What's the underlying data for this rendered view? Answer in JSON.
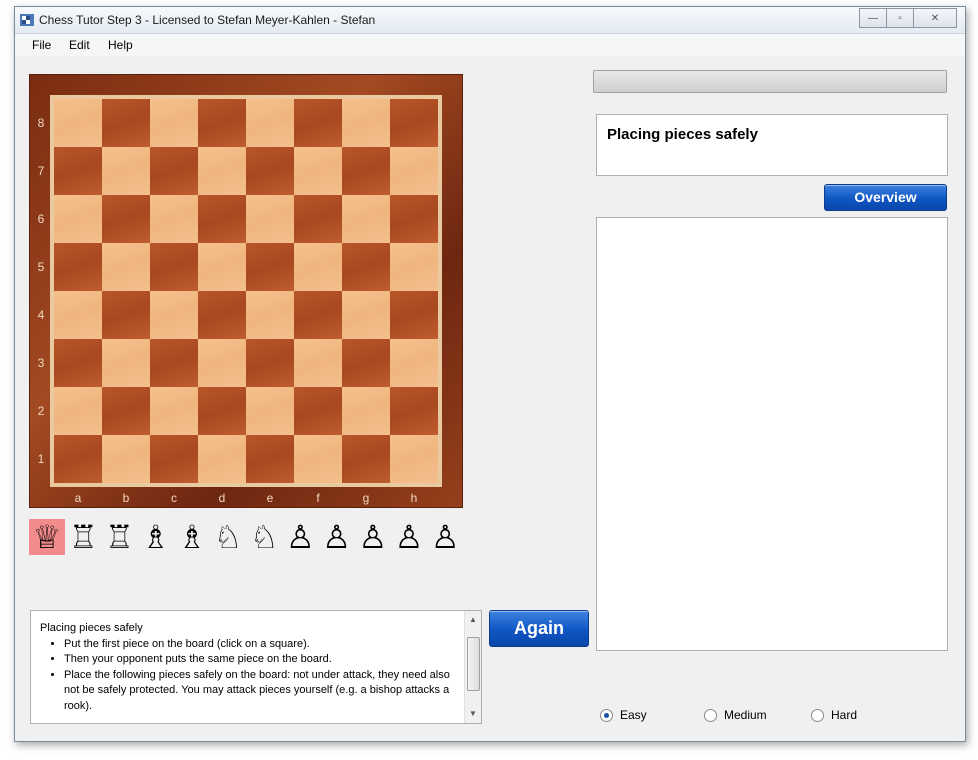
{
  "window": {
    "title": "Chess Tutor Step 3 - Licensed to Stefan Meyer-Kahlen - Stefan",
    "controls": {
      "minimize": "—",
      "maximize": "▫",
      "close": "✕"
    }
  },
  "menu": [
    "File",
    "Edit",
    "Help"
  ],
  "board": {
    "ranks": [
      "8",
      "7",
      "6",
      "5",
      "4",
      "3",
      "2",
      "1"
    ],
    "files": [
      "a",
      "b",
      "c",
      "d",
      "e",
      "f",
      "g",
      "h"
    ],
    "colors": {
      "light": "#f2bc88",
      "dark": "#b0502a",
      "frame": "#8b3a1a"
    }
  },
  "palette": {
    "pieces": [
      {
        "name": "queen",
        "glyph": "♕",
        "selected": true
      },
      {
        "name": "rook",
        "glyph": "♖"
      },
      {
        "name": "rook",
        "glyph": "♖"
      },
      {
        "name": "bishop",
        "glyph": "♗"
      },
      {
        "name": "bishop",
        "glyph": "♗"
      },
      {
        "name": "knight",
        "glyph": "♘"
      },
      {
        "name": "knight",
        "glyph": "♘"
      },
      {
        "name": "pawn",
        "glyph": "♙"
      },
      {
        "name": "pawn",
        "glyph": "♙"
      },
      {
        "name": "pawn",
        "glyph": "♙"
      },
      {
        "name": "pawn",
        "glyph": "♙"
      },
      {
        "name": "pawn",
        "glyph": "♙"
      }
    ]
  },
  "lesson": {
    "title": "Placing pieces safely"
  },
  "buttons": {
    "overview": "Overview",
    "again": "Again"
  },
  "info": {
    "heading": "Placing pieces safely",
    "bullets": [
      "Put the first piece on the board (click on a square).",
      "Then your opponent puts the same piece on the board.",
      "Place the following pieces safely on the board: not under attack, they need also not be safely protected. You may attack pieces yourself (e.g. a bishop attacks a rook)."
    ]
  },
  "difficulty": {
    "options": [
      "Easy",
      "Medium",
      "Hard"
    ],
    "selected": "Easy"
  }
}
